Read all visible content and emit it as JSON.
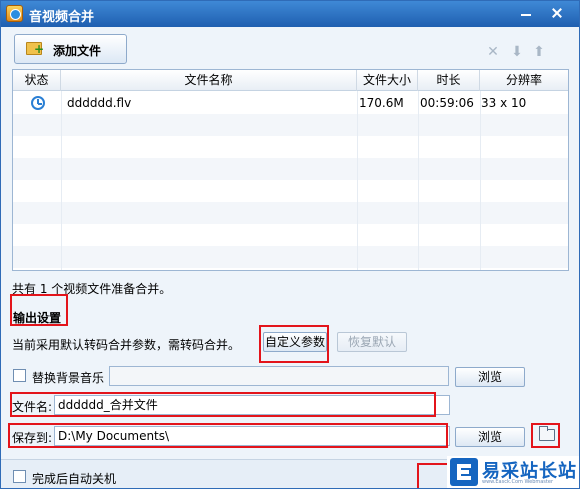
{
  "window": {
    "title": "音视频合并"
  },
  "toolbar": {
    "add_label": "添加文件"
  },
  "table": {
    "headers": {
      "status": "状态",
      "name": "文件名称",
      "size": "文件大小",
      "duration": "时长",
      "resolution": "分辨率"
    },
    "rows": [
      {
        "status_icon": "clock-icon",
        "name": "dddddd.flv",
        "size": "170.6M",
        "duration": "00:59:06",
        "resolution": "33 x 10"
      }
    ]
  },
  "summary": "共有 1 个视频文件准备合并。",
  "output": {
    "section_title": "输出设置",
    "note": "当前采用默认转码合并参数，需转码合并。",
    "custom_button": "自定义参数",
    "restore_button": "恢复默认",
    "bgm_label": "替换背景音乐",
    "bgm_browse": "浏览",
    "filename_label": "文件名:",
    "filename_value": "dddddd_合并文件",
    "save_label": "保存到:",
    "save_value": "D:\\My Documents\\",
    "save_browse": "浏览"
  },
  "footer": {
    "shutdown_label": "完成后自动关机"
  },
  "logo": {
    "text": "易采站长站",
    "sub": "www.Easck.Com Webmaster"
  },
  "colors": {
    "annotation": "#e3141b",
    "accent": "#2f6bb7",
    "logo": "#1565c0"
  }
}
